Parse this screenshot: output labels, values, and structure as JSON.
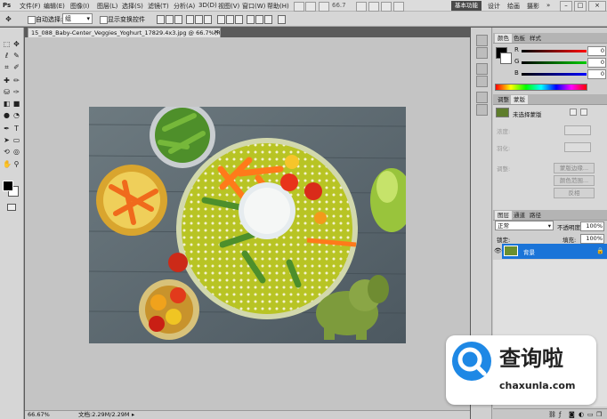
{
  "menubar": {
    "app_logo": "Ps",
    "items": [
      "文件(F)",
      "编辑(E)",
      "图像(I)",
      "图层(L)",
      "选择(S)",
      "滤镜(T)",
      "分析(A)",
      "3D(D)",
      "视图(V)",
      "窗口(W)",
      "帮助(H)"
    ],
    "zoom": "66.7",
    "workspaces": [
      "基本功能",
      "设计",
      "绘画",
      "摄影"
    ],
    "active_workspace": "基本功能",
    "more": "»"
  },
  "options_bar": {
    "auto_select_label": "自动选择:",
    "auto_select_value": "组",
    "show_transform_label": "显示变换控件"
  },
  "document": {
    "tab_title": "15_088_Baby-Center_Veggies_Yoghurt_17829.4x3.jpg @ 66.7%(RGB/8#)",
    "close_icon": "close-icon"
  },
  "statusbar": {
    "zoom": "66.67%",
    "doc_info": "文档:2.29M/2.29M"
  },
  "color_panel": {
    "tabs": [
      "颜色",
      "色板",
      "样式"
    ],
    "channels": [
      {
        "label": "R",
        "value": "0",
        "color": "#e53935"
      },
      {
        "label": "G",
        "value": "0",
        "color": "#43a047"
      },
      {
        "label": "B",
        "value": "0",
        "color": "#1e63d6"
      }
    ]
  },
  "adjust_panel": {
    "tabs": [
      "调整",
      "蒙版"
    ],
    "mask_title": "未选择蒙版",
    "density_label": "浓度:",
    "feather_label": "羽化:",
    "refine_label": "调整:",
    "buttons": [
      "蒙版边缘...",
      "颜色范围...",
      "反相"
    ]
  },
  "layers_panel": {
    "tabs": [
      "图层",
      "通道",
      "路径"
    ],
    "blend_mode": "正常",
    "opacity_label": "不透明度:",
    "opacity": "100%",
    "lock_label": "锁定:",
    "fill_label": "填充:",
    "fill": "100%",
    "layer_name": "背景"
  },
  "watermark": {
    "name": "查询啦",
    "url": "chaxunla.com"
  }
}
